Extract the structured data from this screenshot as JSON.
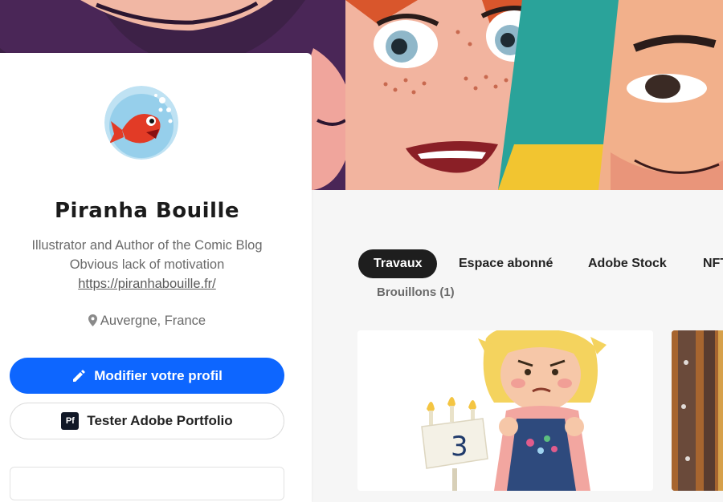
{
  "profile": {
    "name": "Piranha Bouille",
    "bio_line_1": "Illustrator and Author of the Comic Blog",
    "bio_line_2": "Obvious lack of motivation",
    "website": "https://piranhabouille.fr/",
    "location": "Auvergne, France"
  },
  "actions": {
    "edit_profile": "Modifier votre profil",
    "portfolio_icon": "Pf",
    "try_portfolio": "Tester Adobe Portfolio"
  },
  "tabs": [
    {
      "label": "Travaux",
      "active": true
    },
    {
      "label": "Espace abonné",
      "active": false
    },
    {
      "label": "Adobe Stock",
      "active": false
    },
    {
      "label": "NFT",
      "active": false
    }
  ],
  "drafts_tab": "Brouillons (1)",
  "colors": {
    "primary_button": "#0d66ff",
    "active_tab": "#1e1e1e",
    "page_background": "#f6f6f6"
  },
  "icons": {
    "edit": "pencil-icon",
    "location": "map-pin-icon",
    "portfolio": "adobe-portfolio-icon"
  },
  "project_thumbnail_text": "3"
}
